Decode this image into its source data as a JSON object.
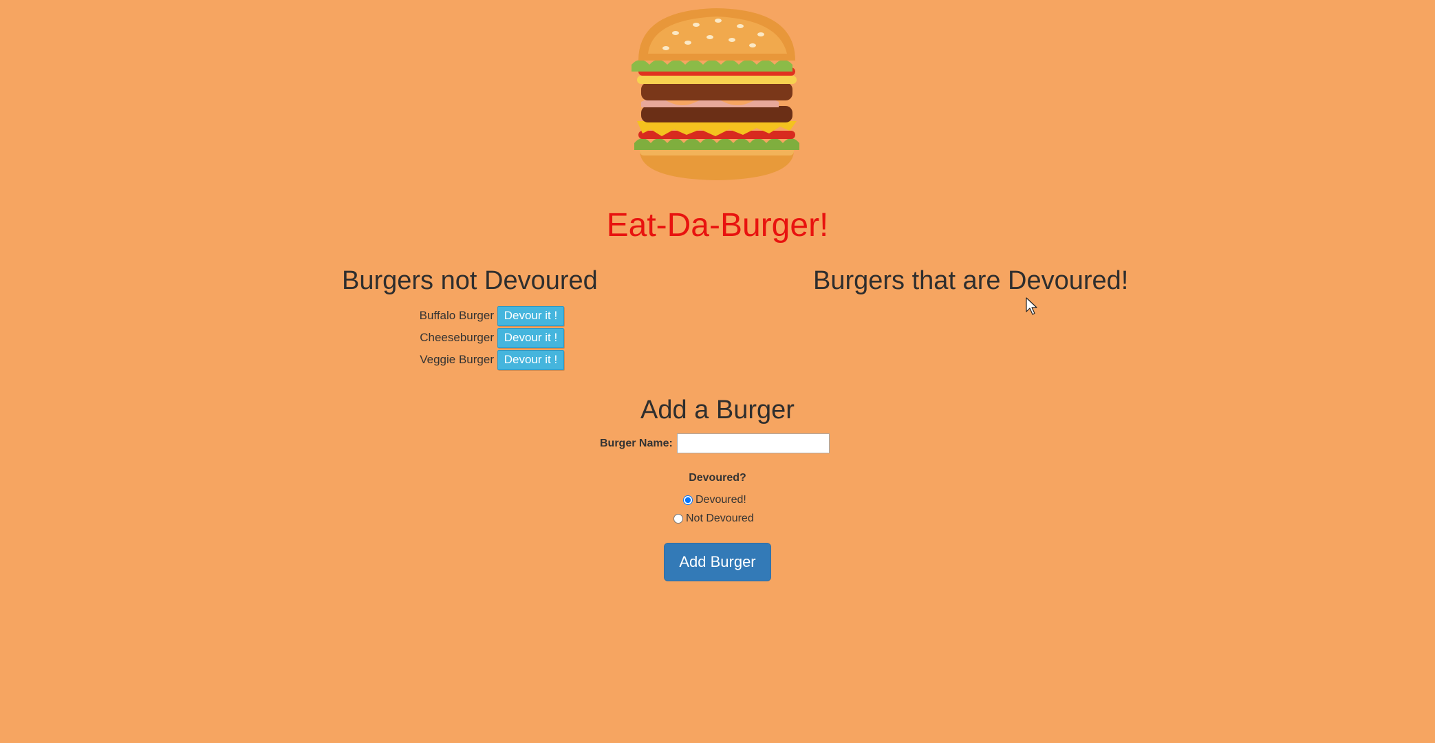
{
  "app": {
    "title": "Eat-Da-Burger!"
  },
  "columns": {
    "not_devoured_heading": "Burgers not Devoured",
    "devoured_heading": "Burgers that are Devoured!"
  },
  "not_devoured": [
    {
      "name": "Buffalo Burger",
      "button_label": "Devour it !"
    },
    {
      "name": "Cheeseburger",
      "button_label": "Devour it !"
    },
    {
      "name": "Veggie Burger",
      "button_label": "Devour it !"
    }
  ],
  "devoured": [],
  "form": {
    "heading": "Add a Burger",
    "name_label": "Burger Name:",
    "name_value": "",
    "question": "Devoured?",
    "options": [
      {
        "label": "Devoured!",
        "checked": true
      },
      {
        "label": "Not Devoured",
        "checked": false
      }
    ],
    "submit_label": "Add Burger"
  },
  "icons": {
    "logo": "burger-logo-icon",
    "cursor": "mouse-cursor-icon"
  },
  "colors": {
    "background": "#f6a561",
    "title": "#e8130f",
    "devour_button": "#45b5dd",
    "add_button": "#337ab7"
  }
}
